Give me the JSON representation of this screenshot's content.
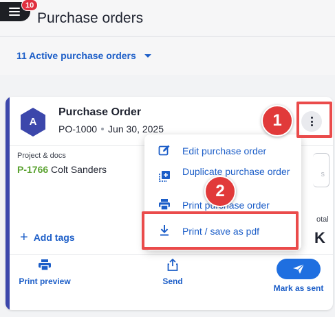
{
  "header": {
    "notification_count": "10",
    "title": "Purchase orders"
  },
  "filter": {
    "label": "11 Active purchase orders"
  },
  "card": {
    "avatar_letter": "A",
    "title": "Purchase Order",
    "po_number": "PO-1000",
    "date": "Jun 30, 2025",
    "project_label": "Project & docs",
    "project_code": "P-1766",
    "project_name": "Colt Sanders",
    "side_box_text": "s",
    "total_label": "otal",
    "total_value": "K",
    "add_tags": "Add tags",
    "actions": {
      "print_preview": "Print preview",
      "send": "Send",
      "mark_as_sent": "Mark as sent"
    }
  },
  "dropdown": {
    "edit": "Edit purchase order",
    "duplicate": "Duplicate purchase order",
    "print": "Print purchase order",
    "pdf": "Print / save as pdf"
  },
  "annotations": {
    "step1": "1",
    "step2": "2"
  },
  "colors": {
    "accent_blue": "#1c5ec8",
    "avatar": "#3c47ab",
    "project_code": "#5aa230",
    "annotation_red": "#e13a3a"
  }
}
